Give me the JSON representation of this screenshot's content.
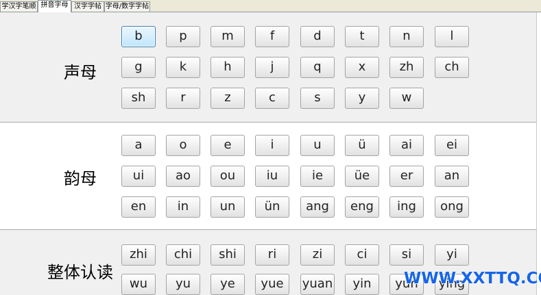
{
  "tabs": [
    {
      "label": "学汉字笔顺",
      "active": false
    },
    {
      "label": "拼音字母",
      "active": true
    },
    {
      "label": "汉字字帖",
      "active": false
    },
    {
      "label": "字母/数字字帖",
      "active": false
    }
  ],
  "sections": [
    {
      "label": "声母",
      "keys": [
        "b",
        "p",
        "m",
        "f",
        "d",
        "t",
        "n",
        "l",
        "g",
        "k",
        "h",
        "j",
        "q",
        "x",
        "zh",
        "ch",
        "sh",
        "r",
        "z",
        "c",
        "s",
        "y",
        "w"
      ]
    },
    {
      "label": "韵母",
      "keys": [
        "a",
        "o",
        "e",
        "i",
        "u",
        "ü",
        "ai",
        "ei",
        "ui",
        "ao",
        "ou",
        "iu",
        "ie",
        "üe",
        "er",
        "an",
        "en",
        "in",
        "un",
        "ün",
        "ang",
        "eng",
        "ing",
        "ong"
      ]
    },
    {
      "label": "整体认读",
      "keys": [
        "zhi",
        "chi",
        "shi",
        "ri",
        "zi",
        "ci",
        "si",
        "yi",
        "wu",
        "yu",
        "ye",
        "yue",
        "yuan",
        "yin",
        "yun",
        "ying"
      ]
    }
  ],
  "selected_key": "b",
  "watermark": "WWW.XXTTQ.COM",
  "colors": {
    "watermark": "#1565e8",
    "selected_key_border": "#3c7fb1"
  }
}
